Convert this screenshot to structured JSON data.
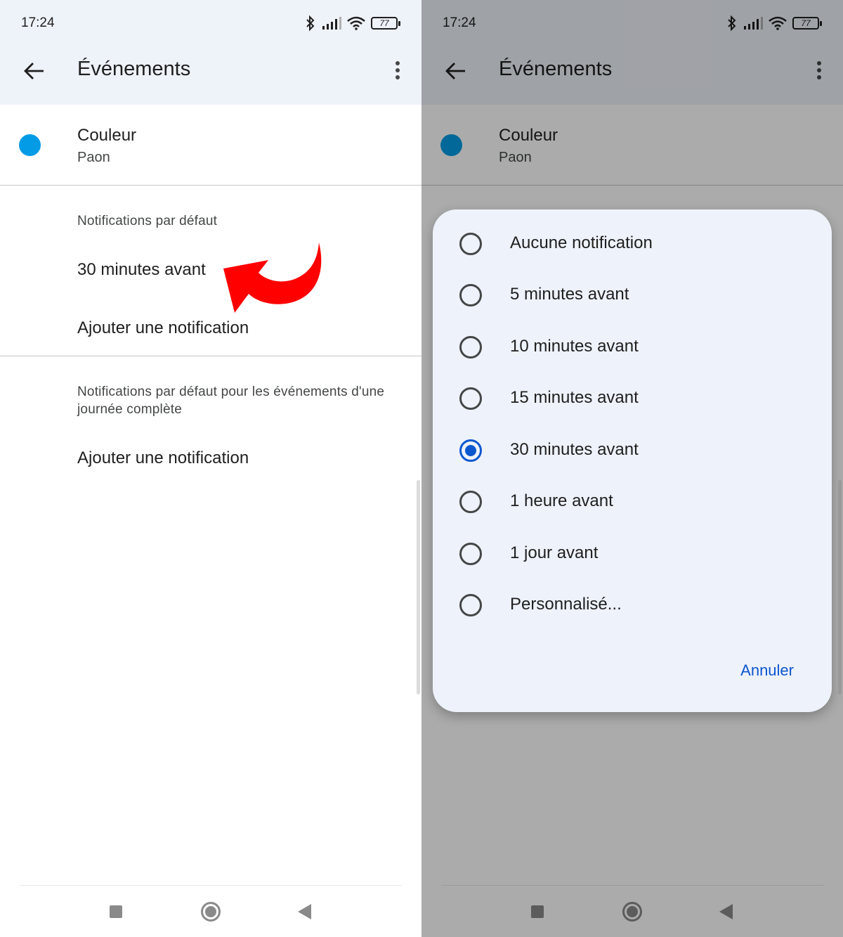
{
  "status_bar": {
    "time": "17:24",
    "battery": "77"
  },
  "app_bar": {
    "title": "Événements",
    "back_icon": "arrow-back-icon",
    "more_icon": "more-vert-icon"
  },
  "color_setting": {
    "label": "Couleur",
    "value": "Paon",
    "swatch_color": "#039be5"
  },
  "default_notifications": {
    "section_label": "Notifications par défaut",
    "current_value": "30 minutes avant",
    "add_label": "Ajouter une notification"
  },
  "all_day_notifications": {
    "section_label": "Notifications par défaut pour les événements d'une journée complète",
    "add_label": "Ajouter une notification"
  },
  "dialog": {
    "options": [
      {
        "label": "Aucune notification",
        "selected": false
      },
      {
        "label": "5 minutes avant",
        "selected": false
      },
      {
        "label": "10 minutes avant",
        "selected": false
      },
      {
        "label": "15 minutes avant",
        "selected": false
      },
      {
        "label": "30 minutes avant",
        "selected": true
      },
      {
        "label": "1 heure avant",
        "selected": false
      },
      {
        "label": "1 jour avant",
        "selected": false
      },
      {
        "label": "Personnalisé...",
        "selected": false
      }
    ],
    "cancel_label": "Annuler"
  },
  "colors": {
    "accent": "#0b57d0",
    "app_bar_bg": "#eef2f9",
    "dialog_bg": "#eef2fb",
    "annotation_arrow": "#ff0000"
  },
  "nav_bar": {
    "recents_icon": "square-icon",
    "home_icon": "circle-home-icon",
    "back_icon": "triangle-back-icon"
  }
}
